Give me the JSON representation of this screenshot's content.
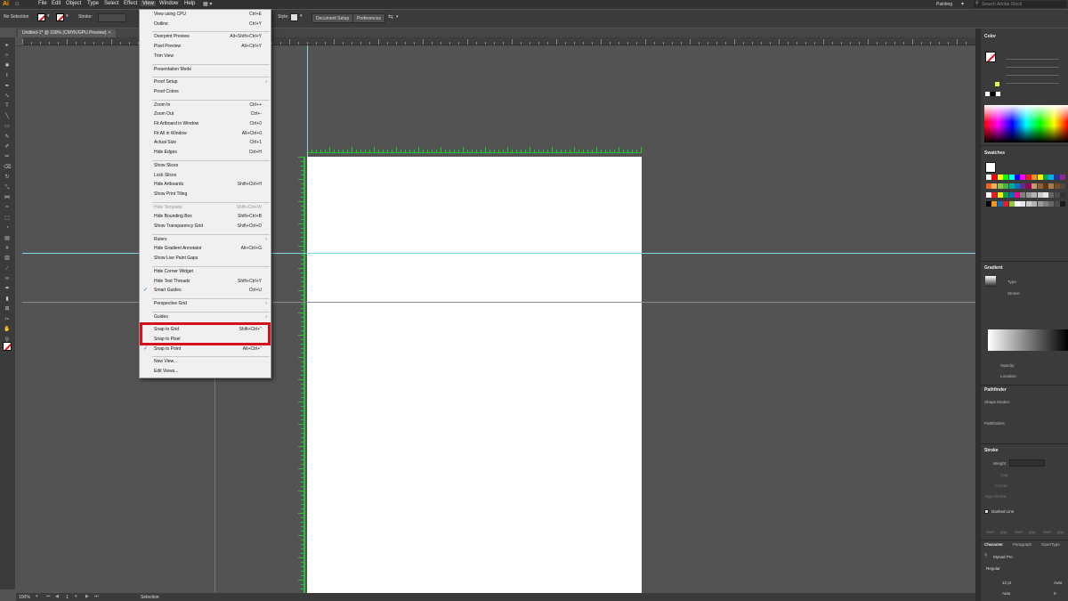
{
  "menubar": {
    "logo": "Ai",
    "items": [
      "File",
      "Edit",
      "Object",
      "Type",
      "Select",
      "Effect",
      "View",
      "Window",
      "Help"
    ],
    "workspace": "Painting",
    "search_placeholder": "Search Adobe Stock"
  },
  "control_bar": {
    "selection_label": "No Selection",
    "stroke_label": "Stroke:",
    "style_label": "Style:",
    "document_setup": "Document Setup",
    "preferences": "Preferences"
  },
  "document": {
    "tab_title": "Untitled-1* @ 100% (CMYK/GPU Preview)",
    "zoom": "100%",
    "artboard_number": "1",
    "status_tool": "Selection"
  },
  "view_menu": {
    "items": [
      {
        "label": "View using CPU",
        "shortcut": "Ctrl+E"
      },
      {
        "label": "Outline",
        "shortcut": "Ctrl+Y"
      },
      {
        "sep": true
      },
      {
        "label": "Overprint Preview",
        "shortcut": "Alt+Shift+Ctrl+Y"
      },
      {
        "label": "Pixel Preview",
        "shortcut": "Alt+Ctrl+Y"
      },
      {
        "label": "Trim View",
        "shortcut": ""
      },
      {
        "sep": true
      },
      {
        "label": "Presentation Mode",
        "shortcut": ""
      },
      {
        "sep": true
      },
      {
        "label": "Proof Setup",
        "shortcut": "",
        "submenu": true
      },
      {
        "label": "Proof Colors",
        "shortcut": ""
      },
      {
        "sep": true
      },
      {
        "label": "Zoom In",
        "shortcut": "Ctrl++"
      },
      {
        "label": "Zoom Out",
        "shortcut": "Ctrl+-"
      },
      {
        "label": "Fit Artboard in Window",
        "shortcut": "Ctrl+0"
      },
      {
        "label": "Fit All in Window",
        "shortcut": "Alt+Ctrl+0"
      },
      {
        "label": "Actual Size",
        "shortcut": "Ctrl+1"
      },
      {
        "label": "Hide Edges",
        "shortcut": "Ctrl+H"
      },
      {
        "sep": true
      },
      {
        "label": "Show Slices",
        "shortcut": ""
      },
      {
        "label": "Lock Slices",
        "shortcut": ""
      },
      {
        "label": "Hide Artboards",
        "shortcut": "Shift+Ctrl+H"
      },
      {
        "label": "Show Print Tiling",
        "shortcut": ""
      },
      {
        "sep": true
      },
      {
        "label": "Hide Template",
        "shortcut": "Shift+Ctrl+W",
        "disabled": true
      },
      {
        "label": "Hide Bounding Box",
        "shortcut": "Shift+Ctrl+B"
      },
      {
        "label": "Show Transparency Grid",
        "shortcut": "Shift+Ctrl+D"
      },
      {
        "sep": true
      },
      {
        "label": "Rulers",
        "shortcut": "",
        "submenu": true
      },
      {
        "label": "Hide Gradient Annotator",
        "shortcut": "Alt+Ctrl+G"
      },
      {
        "label": "Show Live Paint Gaps",
        "shortcut": ""
      },
      {
        "sep": true
      },
      {
        "label": "Hide Corner Widget",
        "shortcut": ""
      },
      {
        "label": "Hide Text Threads",
        "shortcut": "Shift+Ctrl+Y"
      },
      {
        "label": "Smart Guides",
        "shortcut": "Ctrl+U",
        "checked": true
      },
      {
        "sep": true
      },
      {
        "label": "Perspective Grid",
        "shortcut": "",
        "submenu": true
      },
      {
        "sep": true
      },
      {
        "label": "Guides",
        "shortcut": "",
        "submenu": true
      },
      {
        "sep": true
      },
      {
        "label": "Snap to Grid",
        "shortcut": "Shift+Ctrl+\""
      },
      {
        "label": "Snap to Pixel",
        "shortcut": ""
      },
      {
        "label": "Snap to Point",
        "shortcut": "Alt+Ctrl+\"",
        "checked": true
      },
      {
        "sep": true
      },
      {
        "label": "New View...",
        "shortcut": ""
      },
      {
        "label": "Edit Views...",
        "shortcut": ""
      }
    ]
  },
  "panels": {
    "color": {
      "title": "Color"
    },
    "swatches": {
      "title": "Swatches"
    },
    "gradient": {
      "title": "Gradient",
      "type_label": "Type:",
      "stroke_label": "Stroke:",
      "opacity_label": "Opacity:",
      "location_label": "Location:"
    },
    "pathfinder": {
      "title": "Pathfinder",
      "shape_modes": "Shape Modes:",
      "pathfinders": "Pathfinders:"
    },
    "stroke": {
      "title": "Stroke",
      "weight_label": "Weight:",
      "cap_label": "Cap:",
      "corner_label": "Corner:",
      "align_label": "Align Stroke:",
      "dashed_line": "Dashed Line",
      "dash_label": "dash",
      "gap_label": "gap"
    },
    "character": {
      "tabs": [
        "Character",
        "Paragraph",
        "OpenType"
      ],
      "font": "Myriad Pro",
      "style": "Regular",
      "size": "12 pt",
      "leading": "Auto",
      "kerning": "Auto",
      "tracking": "0"
    }
  },
  "colors": {
    "guide_cyan": "#7fd5e0",
    "ruler_green": "#22c334",
    "highlight_red": "#d3121e",
    "menu_bg": "#f0f0f0",
    "check_blue": "#1e6fd9"
  }
}
